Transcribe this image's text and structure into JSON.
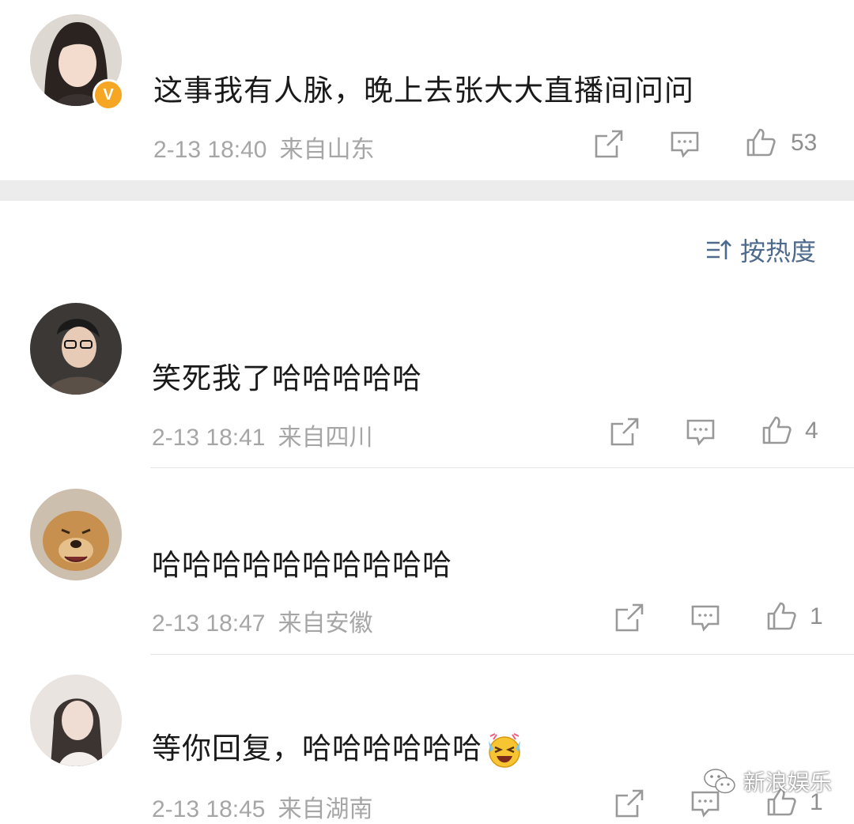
{
  "top_comment": {
    "text": "这事我有人脉，晚上去张大大直播间问问",
    "time": "2-13 18:40",
    "location": "来自山东",
    "likes": "53",
    "verified_badge": "V"
  },
  "sort": {
    "label": "按热度"
  },
  "comments": [
    {
      "text": "笑死我了哈哈哈哈哈",
      "time": "2-13 18:41",
      "location": "来自四川",
      "likes": "4"
    },
    {
      "text": "哈哈哈哈哈哈哈哈哈哈",
      "time": "2-13 18:47",
      "location": "来自安徽",
      "likes": "1"
    },
    {
      "text": "等你回复，哈哈哈哈哈哈",
      "time": "2-13 18:45",
      "location": "来自湖南",
      "likes": "1",
      "emoji": "laughing-crying-emoji"
    }
  ],
  "watermark": {
    "text": "新浪娱乐"
  },
  "colors": {
    "meta": "#a6a6a6",
    "sort_accent": "#4e6a8c",
    "badge": "#f5a623",
    "band": "#ececec"
  }
}
